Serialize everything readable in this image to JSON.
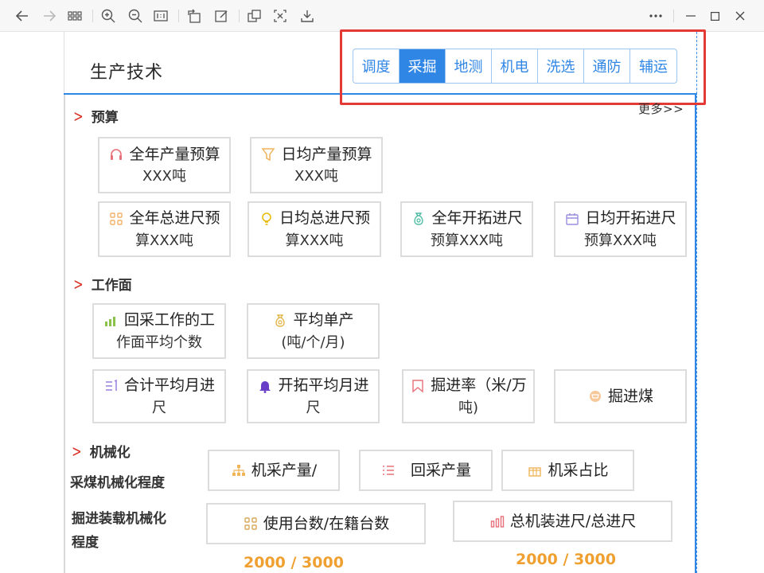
{
  "page": {
    "title": "生产技术",
    "more": "更多>>"
  },
  "tabs": [
    {
      "label": "调度",
      "active": false
    },
    {
      "label": "采掘",
      "active": true
    },
    {
      "label": "地测",
      "active": false
    },
    {
      "label": "机电",
      "active": false
    },
    {
      "label": "洗选",
      "active": false
    },
    {
      "label": "通防",
      "active": false
    },
    {
      "label": "辅运",
      "active": false
    }
  ],
  "sections": {
    "budget": "预算",
    "workface": "工作面",
    "mechanization": "机械化"
  },
  "budget_cards": [
    {
      "title": "全年产量预算",
      "sub": "XXX吨",
      "icon": "headphone-icon"
    },
    {
      "title": "日均产量预算",
      "sub": "XXX吨",
      "icon": "funnel-icon"
    },
    {
      "title": "全年总进尺预",
      "sub": "算XXX吨",
      "icon": "grid-icon"
    },
    {
      "title": "日均总进尺预",
      "sub": "算XXX吨",
      "icon": "bulb-icon"
    },
    {
      "title": "全年开拓进尺",
      "sub": "预算XXX吨",
      "icon": "money-bag-icon"
    },
    {
      "title": "日均开拓进尺",
      "sub": "预算XXX吨",
      "icon": "calendar-icon"
    }
  ],
  "workface_cards": [
    {
      "title": "回采工作的工",
      "sub": "作面平均个数",
      "icon": "bar-chart-icon"
    },
    {
      "title": "平均单产",
      "sub": "(吨/个/月)",
      "icon": "money-bag-icon"
    },
    {
      "title": "合计平均月进",
      "sub": "尺",
      "icon": "list-number-icon"
    },
    {
      "title": "开拓平均月进",
      "sub": "尺",
      "icon": "bell-icon"
    },
    {
      "title": "掘进率（米/万",
      "sub": "吨)",
      "icon": "bookmark-icon"
    },
    {
      "title": "掘进煤",
      "sub": "",
      "icon": "cart-icon"
    }
  ],
  "mechanization": {
    "coal_label": "采煤机械化程度",
    "tunnel_label_line1": "掘进装载机械化",
    "tunnel_label_line2": "程度",
    "cards": [
      {
        "title": "机采产量/",
        "icon": "org-chart-icon"
      },
      {
        "title": "回采产量",
        "icon": "list-icon"
      },
      {
        "title": "机采占比",
        "icon": "gift-icon"
      },
      {
        "title": "使用台数/在籍台数",
        "icon": "grid-icon"
      },
      {
        "title": "总机装进尺/总进尺",
        "icon": "bar-chart-icon"
      }
    ],
    "value_left": "2000 /  3000",
    "value_right": "2000 /  3000"
  },
  "colors": {
    "accent": "#2f86e5",
    "highlight": "#e53935",
    "value": "#f0a030"
  }
}
